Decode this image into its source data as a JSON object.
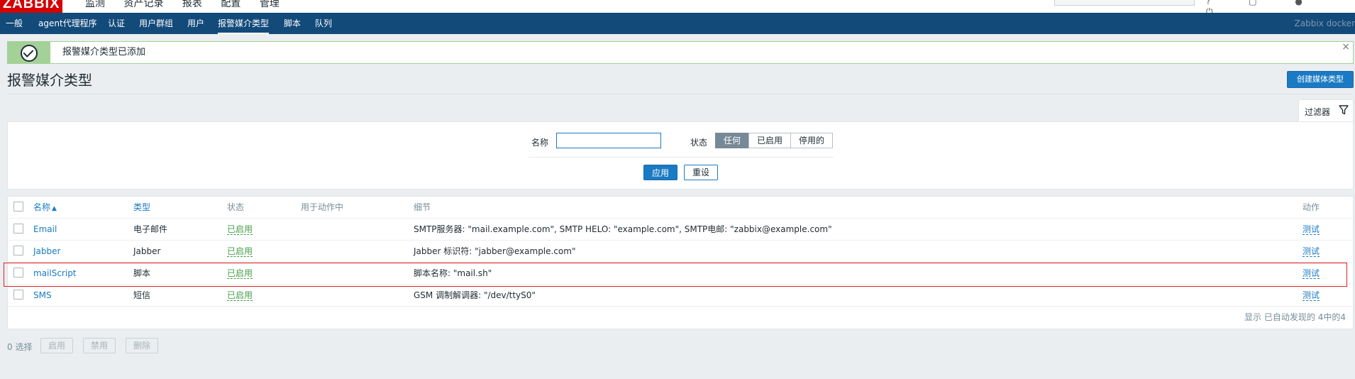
{
  "header": {
    "logo": "ZABBIX",
    "top_menu": [
      "监测",
      "资产记录",
      "报表",
      "配置",
      "管理"
    ]
  },
  "nav": {
    "items": [
      "一般",
      "agent代理程序",
      "认证",
      "用户群组",
      "用户",
      "报警媒介类型",
      "脚本",
      "队列"
    ],
    "active_index": 5,
    "brand": "Zabbix docker"
  },
  "message": {
    "text": "报警媒介类型已添加",
    "close": "×"
  },
  "page": {
    "title": "报警媒介类型",
    "create_button": "创建媒体类型"
  },
  "filter": {
    "tab_label": "过滤器",
    "name_label": "名称",
    "name_value": "",
    "status_label": "状态",
    "status_options": [
      "任何",
      "已启用",
      "停用的"
    ],
    "status_selected": "任何",
    "apply": "应用",
    "reset": "重设"
  },
  "table": {
    "columns": {
      "name": "名称",
      "sort_indicator": "▲",
      "type": "类型",
      "status": "状态",
      "used_in_actions": "用于动作中",
      "details": "细节",
      "action": "动作"
    },
    "rows": [
      {
        "name": "Email",
        "type": "电子邮件",
        "status": "已启用",
        "used": "",
        "details": "SMTP服务器: \"mail.example.com\", SMTP HELO: \"example.com\", SMTP电邮: \"zabbix@example.com\"",
        "action": "测试"
      },
      {
        "name": "Jabber",
        "type": "Jabber",
        "status": "已启用",
        "used": "",
        "details": "Jabber 标识符: \"jabber@example.com\"",
        "action": "测试"
      },
      {
        "name": "mailScript",
        "type": "脚本",
        "status": "已启用",
        "used": "",
        "details": "脚本名称: \"mail.sh\"",
        "action": "测试"
      },
      {
        "name": "SMS",
        "type": "短信",
        "status": "已启用",
        "used": "",
        "details": "GSM 调制解调器: \"/dev/ttyS0\"",
        "action": "测试"
      }
    ],
    "footer": "显示 已自动发现的 4中的4"
  },
  "actions": {
    "selected": "0 选择",
    "enable": "启用",
    "disable": "禁用",
    "delete": "删除"
  },
  "colors": {
    "nav_bg": "#124a7a",
    "accent": "#1a7ac4",
    "enabled_green": "#429e47",
    "success_bg": "#a3d197",
    "highlight_red": "#e02020"
  }
}
